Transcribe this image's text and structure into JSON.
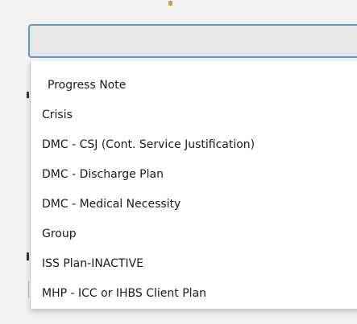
{
  "select": {
    "value": ""
  },
  "dropdown": {
    "options": [
      "Progress Note",
      "Crisis",
      "DMC - CSJ (Cont. Service Justification)",
      "DMC - Discharge Plan",
      "DMC - Medical Necessity",
      "Group",
      "ISS Plan-INACTIVE",
      "MHP - ICC or IHBS Client Plan"
    ]
  },
  "colors": {
    "select_border": "#5b9bd5",
    "select_background": "#e7e7e7",
    "list_background": "#ffffff",
    "page_background": "#f2f2f2"
  }
}
